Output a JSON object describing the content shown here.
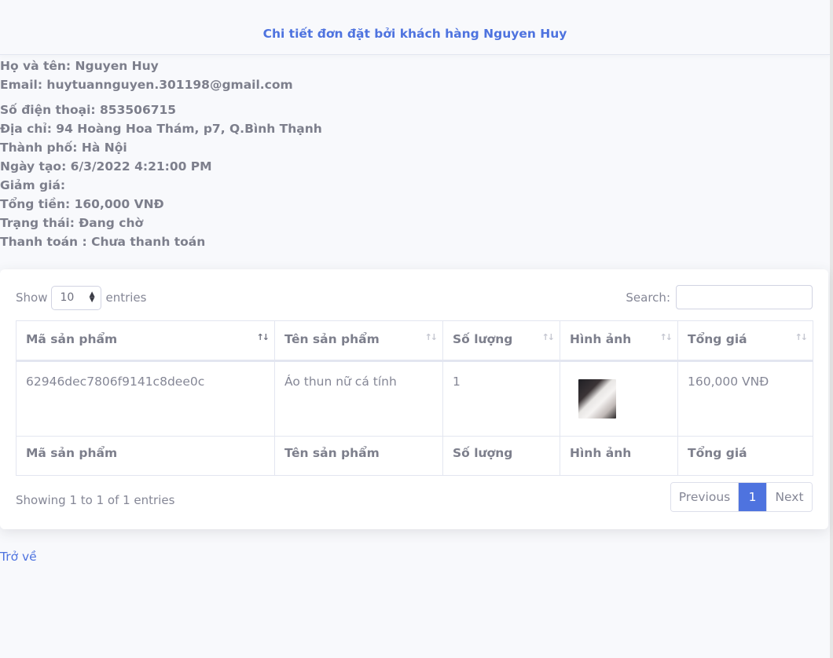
{
  "header": {
    "title": "Chi tiết đơn đặt bởi khách hàng Nguyen Huy"
  },
  "customer": {
    "name": "Họ và tên: Nguyen Huy",
    "email": "Email: huytuannguyen.301198@gmail.com",
    "phone": "Số điện thoại: 853506715",
    "address": "Địa chỉ: 94 Hoàng Hoa Thám, p7, Q.Bình Thạnh",
    "city": "Thành phố: Hà Nội",
    "created": "Ngày tạo: 6/3/2022 4:21:00 PM",
    "discount": "Giảm giá:",
    "total": "Tổng tiền: 160,000 VNĐ",
    "status": "Trạng thái: Đang chờ",
    "payment": "Thanh toán : Chưa thanh toán"
  },
  "table_controls": {
    "show_label": "Show",
    "entries_label": "entries",
    "page_length": "10",
    "search_label": "Search:",
    "search_value": ""
  },
  "table": {
    "columns": [
      "Mã sản phẩm",
      "Tên sản phẩm",
      "Số lượng",
      "Hình ảnh",
      "Tổng giá"
    ],
    "rows": [
      {
        "id": "62946dec7806f9141c8dee0c",
        "name": "Áo thun nữ cá tính",
        "qty": "1",
        "image": "product-thumbnail",
        "price": "160,000 VNĐ"
      }
    ]
  },
  "footer": {
    "info": "Showing 1 to 1 of 1 entries",
    "prev": "Previous",
    "page": "1",
    "next": "Next"
  },
  "back_link": "Trở về",
  "colors": {
    "primary": "#4e73df",
    "text": "#858796"
  },
  "icons": {
    "sort": "sort-arrows-icon",
    "select": "select-chevron-icon"
  }
}
